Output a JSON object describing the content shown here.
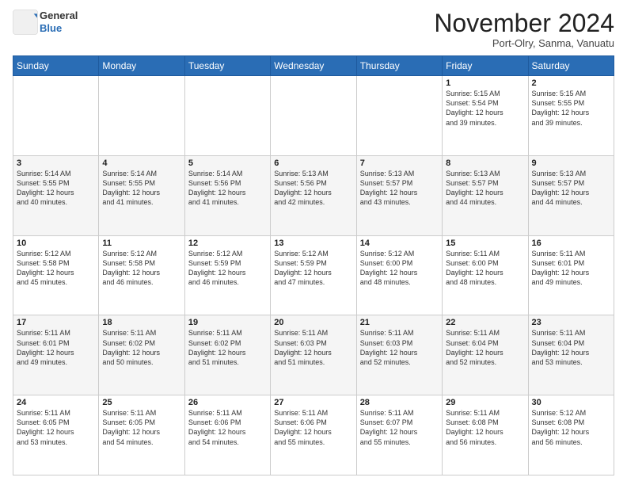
{
  "header": {
    "logo_general": "General",
    "logo_blue": "Blue",
    "month": "November 2024",
    "location": "Port-Olry, Sanma, Vanuatu"
  },
  "weekdays": [
    "Sunday",
    "Monday",
    "Tuesday",
    "Wednesday",
    "Thursday",
    "Friday",
    "Saturday"
  ],
  "weeks": [
    [
      {
        "day": "",
        "info": ""
      },
      {
        "day": "",
        "info": ""
      },
      {
        "day": "",
        "info": ""
      },
      {
        "day": "",
        "info": ""
      },
      {
        "day": "",
        "info": ""
      },
      {
        "day": "1",
        "info": "Sunrise: 5:15 AM\nSunset: 5:54 PM\nDaylight: 12 hours\nand 39 minutes."
      },
      {
        "day": "2",
        "info": "Sunrise: 5:15 AM\nSunset: 5:55 PM\nDaylight: 12 hours\nand 39 minutes."
      }
    ],
    [
      {
        "day": "3",
        "info": "Sunrise: 5:14 AM\nSunset: 5:55 PM\nDaylight: 12 hours\nand 40 minutes."
      },
      {
        "day": "4",
        "info": "Sunrise: 5:14 AM\nSunset: 5:55 PM\nDaylight: 12 hours\nand 41 minutes."
      },
      {
        "day": "5",
        "info": "Sunrise: 5:14 AM\nSunset: 5:56 PM\nDaylight: 12 hours\nand 41 minutes."
      },
      {
        "day": "6",
        "info": "Sunrise: 5:13 AM\nSunset: 5:56 PM\nDaylight: 12 hours\nand 42 minutes."
      },
      {
        "day": "7",
        "info": "Sunrise: 5:13 AM\nSunset: 5:57 PM\nDaylight: 12 hours\nand 43 minutes."
      },
      {
        "day": "8",
        "info": "Sunrise: 5:13 AM\nSunset: 5:57 PM\nDaylight: 12 hours\nand 44 minutes."
      },
      {
        "day": "9",
        "info": "Sunrise: 5:13 AM\nSunset: 5:57 PM\nDaylight: 12 hours\nand 44 minutes."
      }
    ],
    [
      {
        "day": "10",
        "info": "Sunrise: 5:12 AM\nSunset: 5:58 PM\nDaylight: 12 hours\nand 45 minutes."
      },
      {
        "day": "11",
        "info": "Sunrise: 5:12 AM\nSunset: 5:58 PM\nDaylight: 12 hours\nand 46 minutes."
      },
      {
        "day": "12",
        "info": "Sunrise: 5:12 AM\nSunset: 5:59 PM\nDaylight: 12 hours\nand 46 minutes."
      },
      {
        "day": "13",
        "info": "Sunrise: 5:12 AM\nSunset: 5:59 PM\nDaylight: 12 hours\nand 47 minutes."
      },
      {
        "day": "14",
        "info": "Sunrise: 5:12 AM\nSunset: 6:00 PM\nDaylight: 12 hours\nand 48 minutes."
      },
      {
        "day": "15",
        "info": "Sunrise: 5:11 AM\nSunset: 6:00 PM\nDaylight: 12 hours\nand 48 minutes."
      },
      {
        "day": "16",
        "info": "Sunrise: 5:11 AM\nSunset: 6:01 PM\nDaylight: 12 hours\nand 49 minutes."
      }
    ],
    [
      {
        "day": "17",
        "info": "Sunrise: 5:11 AM\nSunset: 6:01 PM\nDaylight: 12 hours\nand 49 minutes."
      },
      {
        "day": "18",
        "info": "Sunrise: 5:11 AM\nSunset: 6:02 PM\nDaylight: 12 hours\nand 50 minutes."
      },
      {
        "day": "19",
        "info": "Sunrise: 5:11 AM\nSunset: 6:02 PM\nDaylight: 12 hours\nand 51 minutes."
      },
      {
        "day": "20",
        "info": "Sunrise: 5:11 AM\nSunset: 6:03 PM\nDaylight: 12 hours\nand 51 minutes."
      },
      {
        "day": "21",
        "info": "Sunrise: 5:11 AM\nSunset: 6:03 PM\nDaylight: 12 hours\nand 52 minutes."
      },
      {
        "day": "22",
        "info": "Sunrise: 5:11 AM\nSunset: 6:04 PM\nDaylight: 12 hours\nand 52 minutes."
      },
      {
        "day": "23",
        "info": "Sunrise: 5:11 AM\nSunset: 6:04 PM\nDaylight: 12 hours\nand 53 minutes."
      }
    ],
    [
      {
        "day": "24",
        "info": "Sunrise: 5:11 AM\nSunset: 6:05 PM\nDaylight: 12 hours\nand 53 minutes."
      },
      {
        "day": "25",
        "info": "Sunrise: 5:11 AM\nSunset: 6:05 PM\nDaylight: 12 hours\nand 54 minutes."
      },
      {
        "day": "26",
        "info": "Sunrise: 5:11 AM\nSunset: 6:06 PM\nDaylight: 12 hours\nand 54 minutes."
      },
      {
        "day": "27",
        "info": "Sunrise: 5:11 AM\nSunset: 6:06 PM\nDaylight: 12 hours\nand 55 minutes."
      },
      {
        "day": "28",
        "info": "Sunrise: 5:11 AM\nSunset: 6:07 PM\nDaylight: 12 hours\nand 55 minutes."
      },
      {
        "day": "29",
        "info": "Sunrise: 5:11 AM\nSunset: 6:08 PM\nDaylight: 12 hours\nand 56 minutes."
      },
      {
        "day": "30",
        "info": "Sunrise: 5:12 AM\nSunset: 6:08 PM\nDaylight: 12 hours\nand 56 minutes."
      }
    ]
  ]
}
